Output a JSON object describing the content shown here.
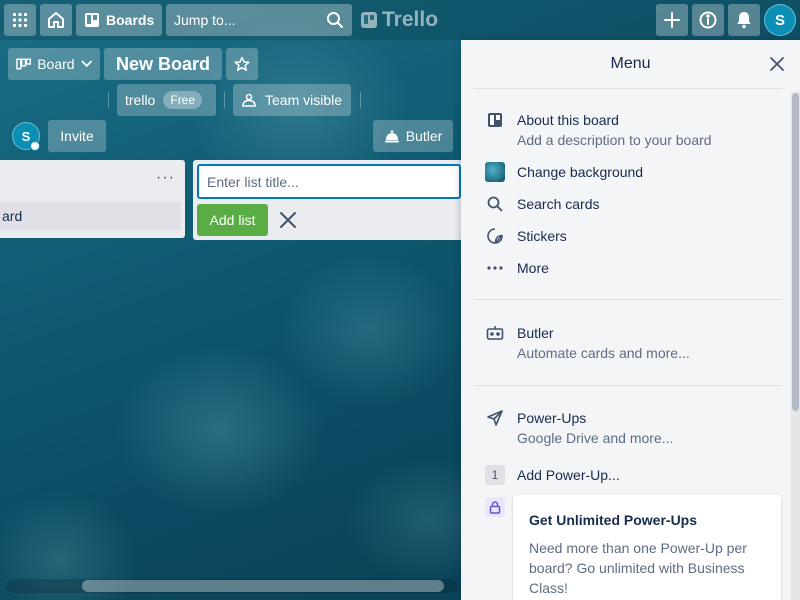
{
  "header": {
    "boards_label": "Boards",
    "search_placeholder": "Jump to...",
    "logo_text": "Trello",
    "avatar_initial": "S"
  },
  "board": {
    "view_label": "Board",
    "title": "New Board",
    "team_name": "trello",
    "team_plan": "Free",
    "visibility": "Team visible",
    "member_initial": "S",
    "invite_label": "Invite",
    "butler_label": "Butler"
  },
  "lists": {
    "existing_card_text": "ard",
    "new_list_placeholder": "Enter list title...",
    "add_list_label": "Add list"
  },
  "menu": {
    "title": "Menu",
    "items": [
      {
        "label": "About this board",
        "sub": "Add a description to your board",
        "icon": "board-icon"
      },
      {
        "label": "Change background",
        "sub": "",
        "icon": "background-thumbnail"
      },
      {
        "label": "Search cards",
        "sub": "",
        "icon": "search-icon"
      },
      {
        "label": "Stickers",
        "sub": "",
        "icon": "sticker-icon"
      },
      {
        "label": "More",
        "sub": "",
        "icon": "more-icon"
      }
    ],
    "butler": {
      "label": "Butler",
      "sub": "Automate cards and more..."
    },
    "powerups": {
      "label": "Power-Ups",
      "sub": "Google Drive and more..."
    },
    "add_powerup": {
      "count": "1",
      "label": "Add Power-Up..."
    },
    "upsell": {
      "title": "Get Unlimited Power-Ups",
      "body": "Need more than one Power-Up per board? Go unlimited with Business Class!"
    }
  },
  "colors": {
    "accent_blue": "#0079bf",
    "add_green": "#5aac44",
    "avatar": "#0c8fb5",
    "menu_bg": "#f4f5f7"
  }
}
